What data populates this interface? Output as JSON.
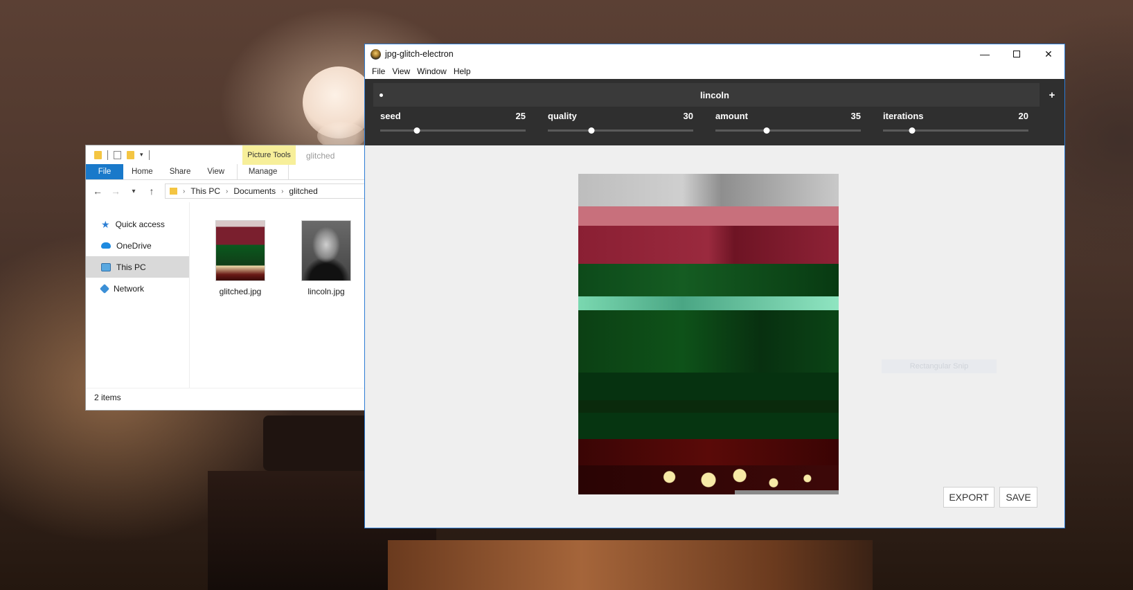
{
  "explorer": {
    "ribbon_context": "Picture Tools",
    "title": "glitched",
    "tabs": [
      "File",
      "Home",
      "Share",
      "View",
      "Manage"
    ],
    "breadcrumb": [
      "This PC",
      "Documents",
      "glitched"
    ],
    "nav": [
      "Quick access",
      "OneDrive",
      "This PC",
      "Network"
    ],
    "files": [
      "glitched.jpg",
      "lincoln.jpg"
    ],
    "status": "2 items"
  },
  "app": {
    "title": "jpg-glitch-electron",
    "menu": [
      "File",
      "View",
      "Window",
      "Help"
    ],
    "tab": {
      "title": "lincoln",
      "close": "x",
      "add": "+"
    },
    "sliders": [
      {
        "label": "seed",
        "value": "25",
        "fraction": 0.25
      },
      {
        "label": "quality",
        "value": "30",
        "fraction": 0.3
      },
      {
        "label": "amount",
        "value": "35",
        "fraction": 0.35
      },
      {
        "label": "iterations",
        "value": "20",
        "fraction": 0.2
      }
    ],
    "snip_text": "Rectangular Snip",
    "buttons": {
      "export": "EXPORT",
      "save": "SAVE"
    }
  },
  "colors": {
    "accent_blue": "#1979ca",
    "window_border": "#2b7bd4",
    "toolbar_bg": "#2f2f2f",
    "picture_tools": "#f7ef9a"
  }
}
